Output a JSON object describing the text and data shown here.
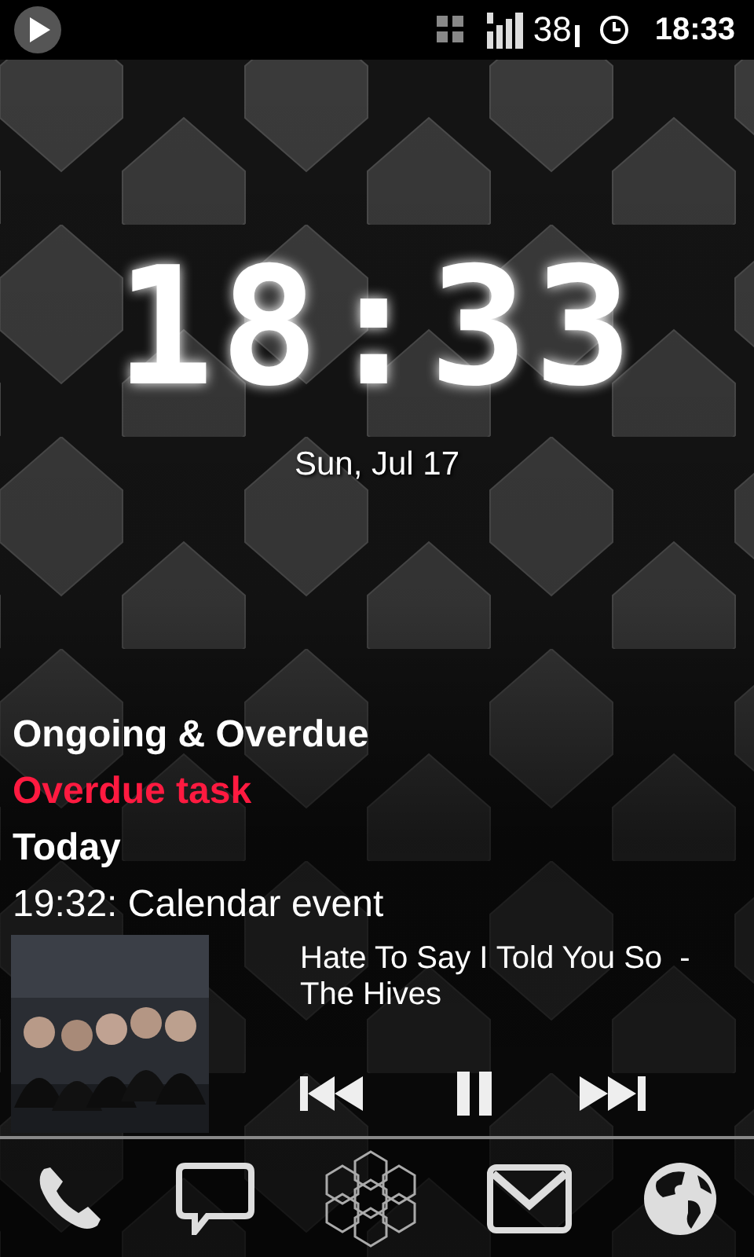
{
  "status_bar": {
    "battery": "38",
    "time": "18:33"
  },
  "clock": {
    "time": "18:33",
    "date": "Sun, Jul 17"
  },
  "agenda": [
    {
      "kind": "heading",
      "text": "Ongoing & Overdue"
    },
    {
      "kind": "overdue",
      "text": "Overdue task"
    },
    {
      "kind": "heading",
      "text": "Today"
    },
    {
      "kind": "event",
      "text": "19:32: Calendar event"
    }
  ],
  "music": {
    "title": "Hate To Say I Told You So  -",
    "artist": "The Hives",
    "playing": true
  }
}
